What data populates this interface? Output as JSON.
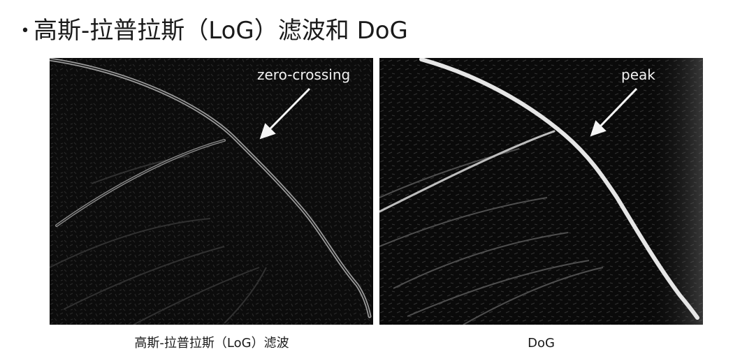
{
  "slide": {
    "bullet": "•",
    "title": "高斯-拉普拉斯（LoG）滤波和 DoG"
  },
  "panels": [
    {
      "annotation": "zero-crossing",
      "caption": "高斯-拉普拉斯（LoG）滤波"
    },
    {
      "annotation": "peak",
      "caption": "DoG"
    }
  ]
}
